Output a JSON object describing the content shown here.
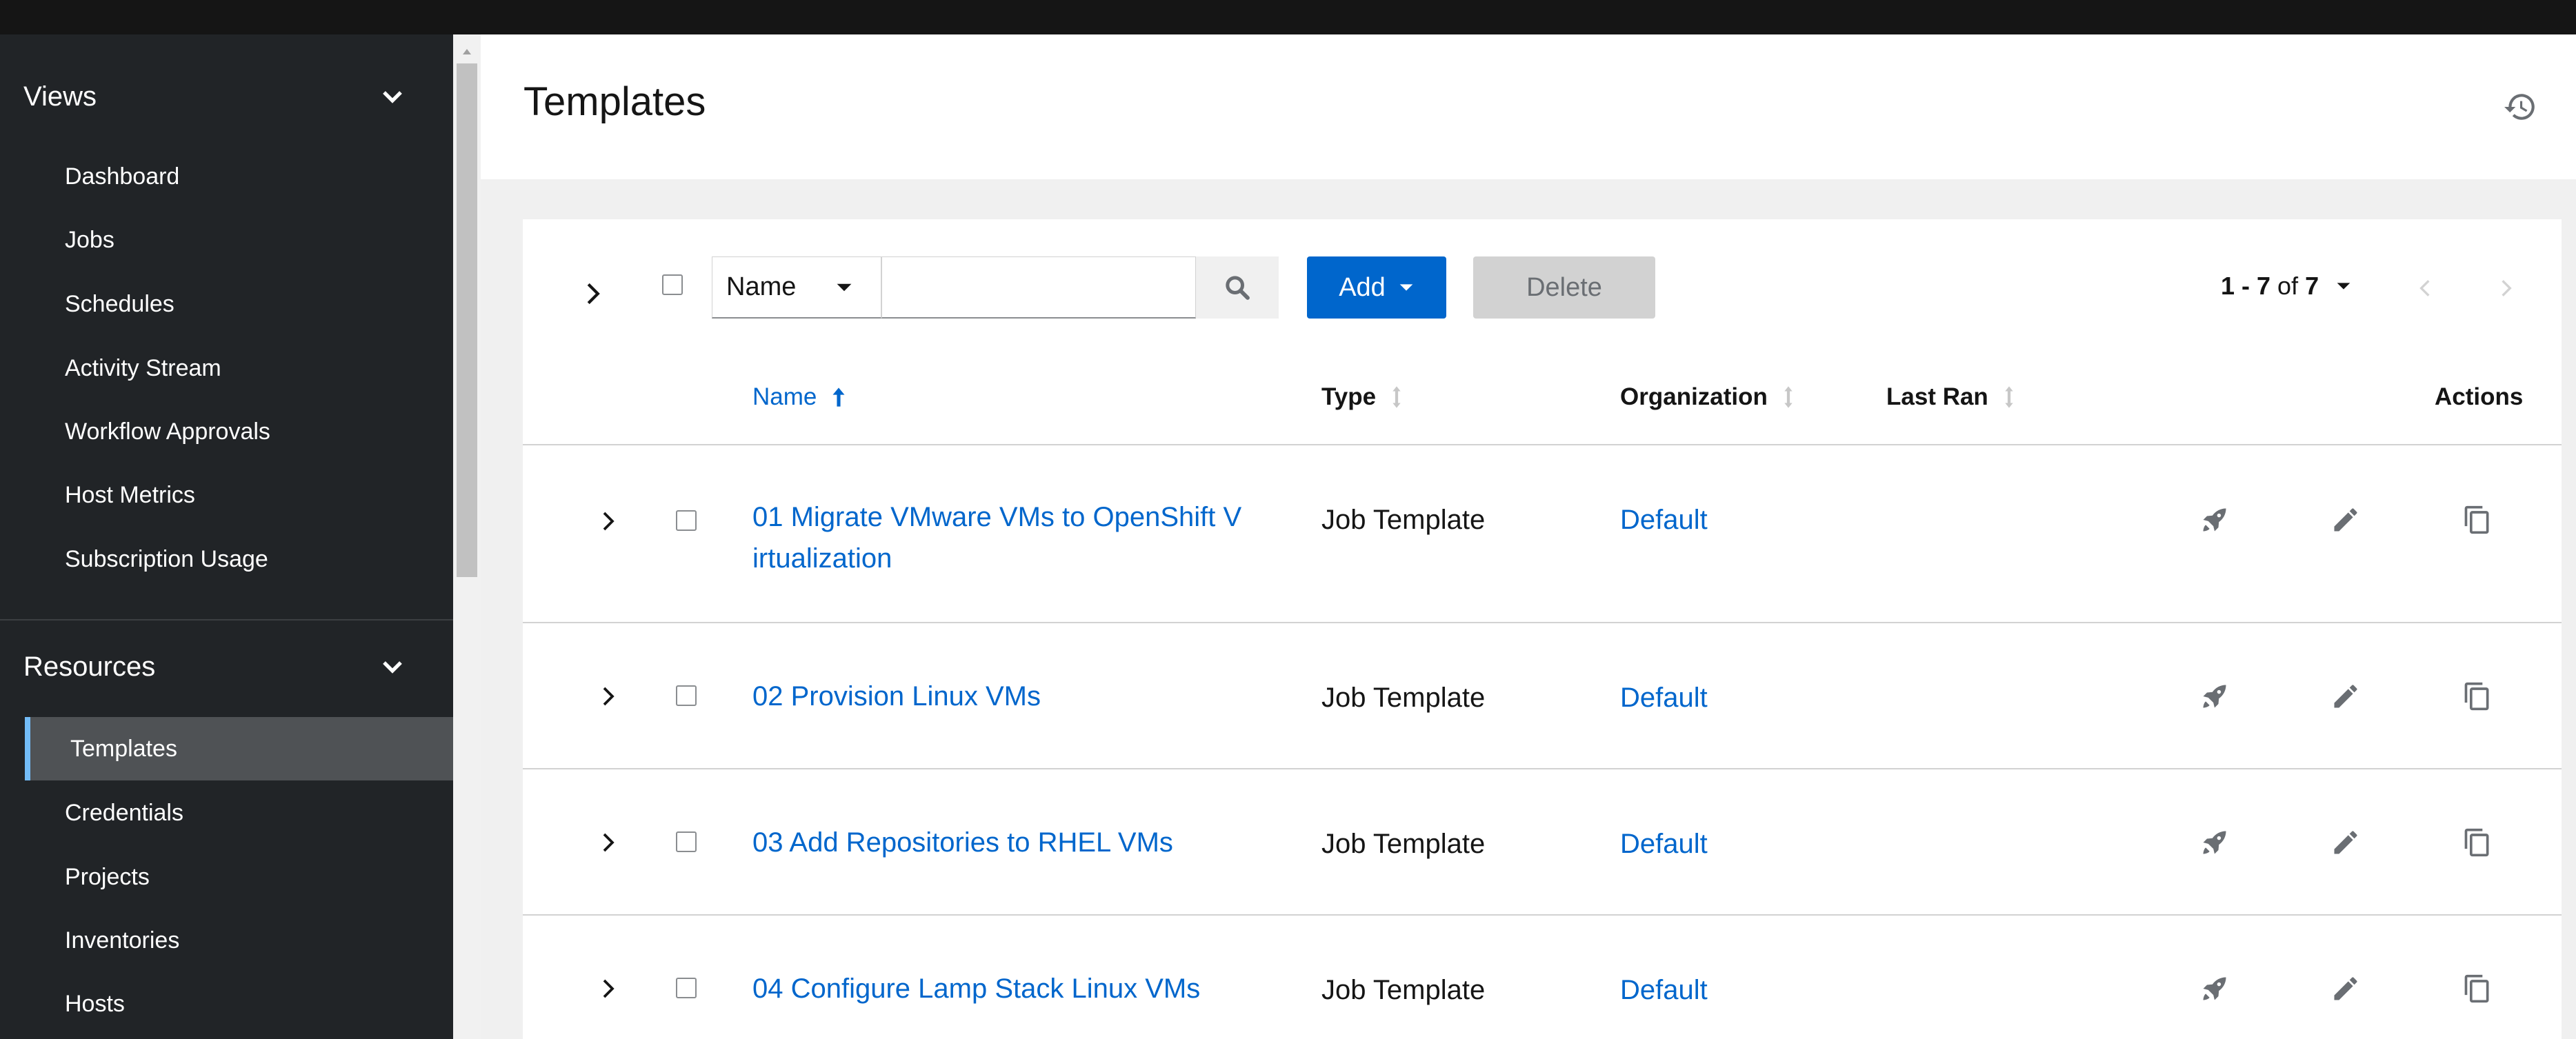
{
  "sidebar": {
    "groups": [
      {
        "label": "Views",
        "items": [
          {
            "label": "Dashboard"
          },
          {
            "label": "Jobs"
          },
          {
            "label": "Schedules"
          },
          {
            "label": "Activity Stream"
          },
          {
            "label": "Workflow Approvals"
          },
          {
            "label": "Host Metrics"
          },
          {
            "label": "Subscription Usage"
          }
        ]
      },
      {
        "label": "Resources",
        "items": [
          {
            "label": "Templates",
            "active": true
          },
          {
            "label": "Credentials"
          },
          {
            "label": "Projects"
          },
          {
            "label": "Inventories"
          },
          {
            "label": "Hosts"
          }
        ]
      }
    ]
  },
  "page": {
    "title": "Templates"
  },
  "toolbar": {
    "filter_label": "Name",
    "search_value": "",
    "add_label": "Add",
    "delete_label": "Delete",
    "pagination_range": "1 - 7",
    "pagination_of": "of",
    "pagination_total": "7"
  },
  "table": {
    "columns": {
      "name": "Name",
      "type": "Type",
      "organization": "Organization",
      "last_ran": "Last Ran",
      "actions": "Actions"
    },
    "rows": [
      {
        "name": "01 Migrate VMware VMs to OpenShift V irtualization",
        "type": "Job Template",
        "organization": "Default",
        "last_ran": ""
      },
      {
        "name": "02 Provision Linux VMs",
        "type": "Job Template",
        "organization": "Default",
        "last_ran": ""
      },
      {
        "name": "03 Add Repositories to RHEL VMs",
        "type": "Job Template",
        "organization": "Default",
        "last_ran": ""
      },
      {
        "name": "04 Configure Lamp Stack Linux VMs",
        "type": "Job Template",
        "organization": "Default",
        "last_ran": ""
      }
    ]
  },
  "colors": {
    "link": "#0066cc",
    "sidebar_bg": "#212427",
    "sidebar_active": "#4f5255",
    "active_accent": "#73bcf7",
    "topbar": "#151515"
  }
}
